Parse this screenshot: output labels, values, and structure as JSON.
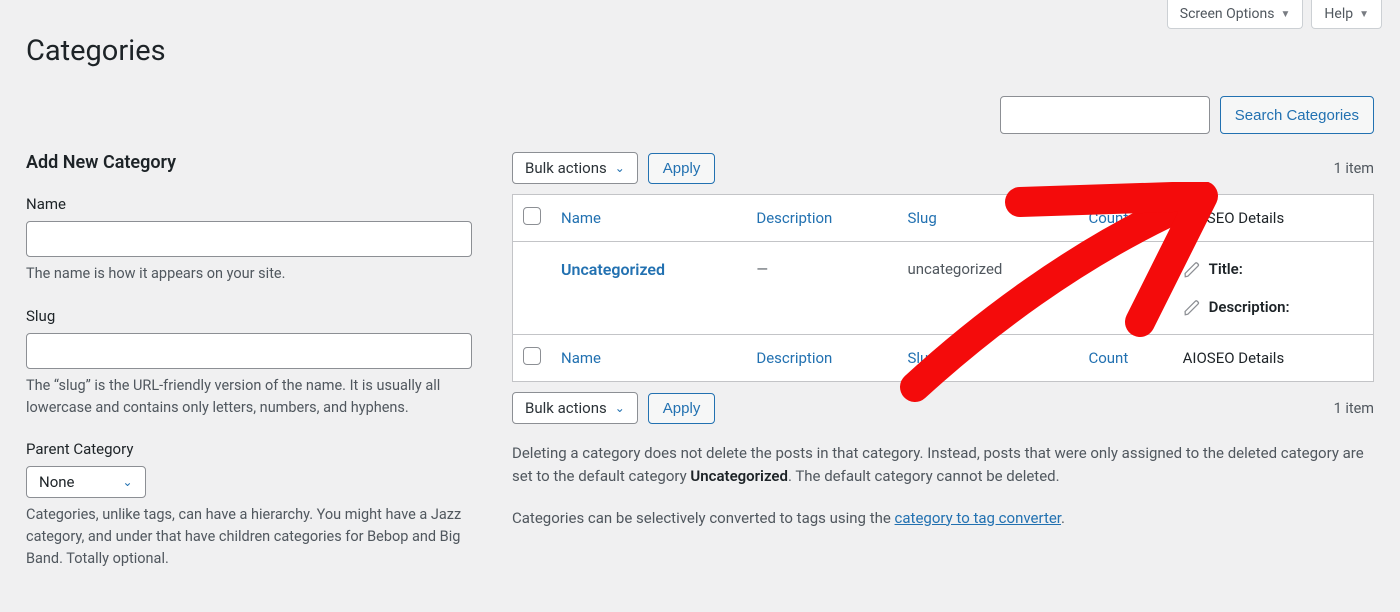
{
  "topTabs": {
    "screenOptions": "Screen Options",
    "help": "Help"
  },
  "page": {
    "title": "Categories"
  },
  "search": {
    "buttonLabel": "Search Categories"
  },
  "form": {
    "heading": "Add New Category",
    "nameLabel": "Name",
    "nameHelp": "The name is how it appears on your site.",
    "slugLabel": "Slug",
    "slugHelp": "The “slug” is the URL-friendly version of the name. It is usually all lowercase and contains only letters, numbers, and hyphens.",
    "parentLabel": "Parent Category",
    "parentValue": "None",
    "parentHelp": "Categories, unlike tags, can have a hierarchy. You might have a Jazz category, and under that have children categories for Bebop and Big Band. Totally optional."
  },
  "table": {
    "bulkActionsLabel": "Bulk actions",
    "applyLabel": "Apply",
    "itemCount": "1 item",
    "columns": {
      "name": "Name",
      "description": "Description",
      "slug": "Slug",
      "count": "Count",
      "aioseo": "AIOSEO Details"
    },
    "rows": [
      {
        "name": "Uncategorized",
        "description": "—",
        "slug": "uncategorized",
        "count": "",
        "aioseo": {
          "titleLabel": "Title:",
          "descLabel": "Description:"
        }
      }
    ]
  },
  "notes": {
    "delete_a": "Deleting a category does not delete the posts in that category. Instead, posts that were only assigned to the deleted category are set to the default category ",
    "delete_b": "Uncategorized",
    "delete_c": ". The default category cannot be deleted.",
    "convert_a": "Categories can be selectively converted to tags using the ",
    "convert_link": "category to tag converter",
    "convert_b": "."
  }
}
